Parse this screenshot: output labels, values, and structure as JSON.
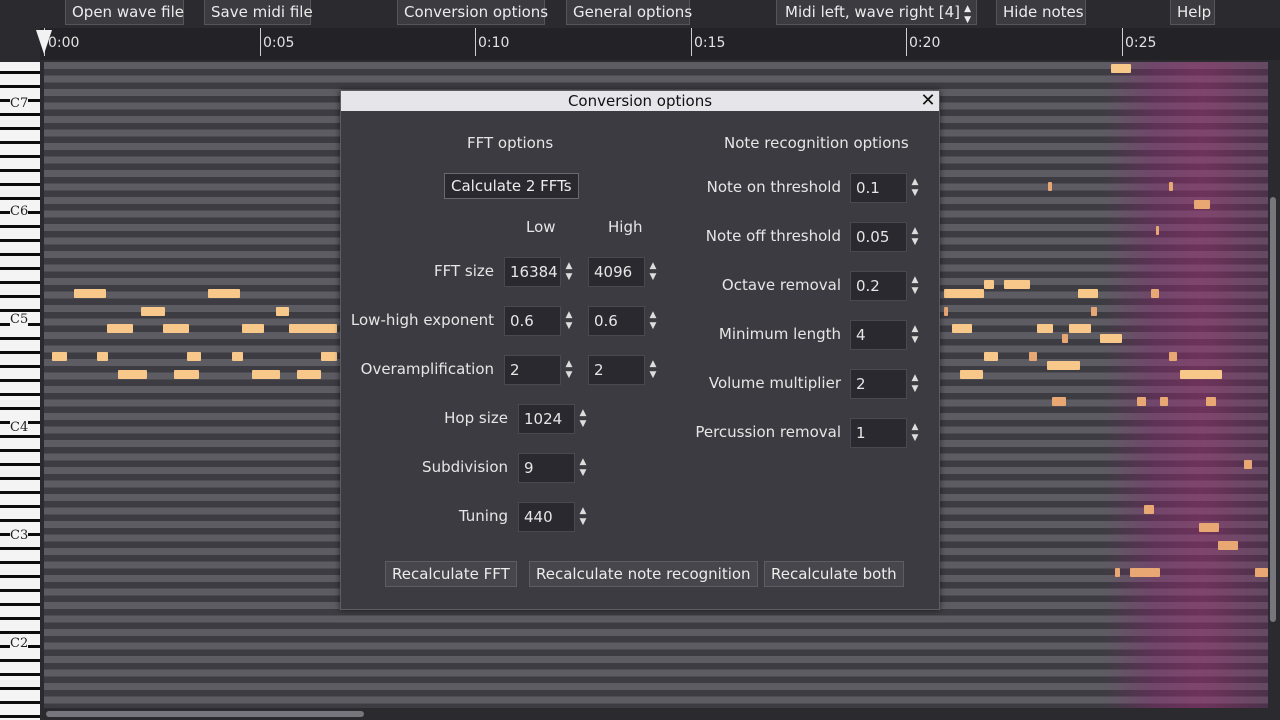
{
  "toolbar": {
    "open_wave": "Open wave file",
    "save_midi": "Save midi file",
    "conversion_options": "Conversion options",
    "general_options": "General options",
    "view_mode": "Midi left, wave right [4]",
    "hide_notes": "Hide notes",
    "help": "Help"
  },
  "timeline": {
    "ticks": [
      "0:00",
      "0:05",
      "0:10",
      "0:15",
      "0:20",
      "0:25"
    ]
  },
  "keyboard": {
    "octaves": [
      "C7",
      "C6",
      "C5",
      "C4",
      "C3",
      "C2"
    ]
  },
  "dialog": {
    "title": "Conversion options",
    "close": "✕",
    "fft_section": "FFT options",
    "calc_label": "Calculate 2 FFTs",
    "col_low": "Low",
    "col_high": "High",
    "fft_size": {
      "label": "FFT size",
      "low": "16384",
      "high": "4096"
    },
    "low_high_exponent": {
      "label": "Low-high exponent",
      "low": "0.6",
      "high": "0.6"
    },
    "overamplification": {
      "label": "Overamplification",
      "low": "2",
      "high": "2"
    },
    "hop_size": {
      "label": "Hop size",
      "value": "1024"
    },
    "subdivision": {
      "label": "Subdivision",
      "value": "9"
    },
    "tuning": {
      "label": "Tuning",
      "value": "440"
    },
    "note_section": "Note recognition options",
    "note_on": {
      "label": "Note on threshold",
      "value": "0.1"
    },
    "note_off": {
      "label": "Note off threshold",
      "value": "0.05"
    },
    "octave_removal": {
      "label": "Octave removal",
      "value": "0.2"
    },
    "min_length": {
      "label": "Minimum length",
      "value": "4"
    },
    "volume_multiplier": {
      "label": "Volume multiplier",
      "value": "2"
    },
    "percussion_removal": {
      "label": "Percussion removal",
      "value": "1"
    },
    "recalc_fft": "Recalculate FFT",
    "recalc_notes": "Recalculate note recognition",
    "recalc_both": "Recalculate both"
  },
  "icons": {
    "spinner": "up-down-arrows-icon",
    "close": "close-icon",
    "playhead": "playhead-triangle-icon"
  },
  "colors": {
    "note": "#f8c88a",
    "background": "#2b2a2f",
    "dialog": "#3c3b41"
  }
}
